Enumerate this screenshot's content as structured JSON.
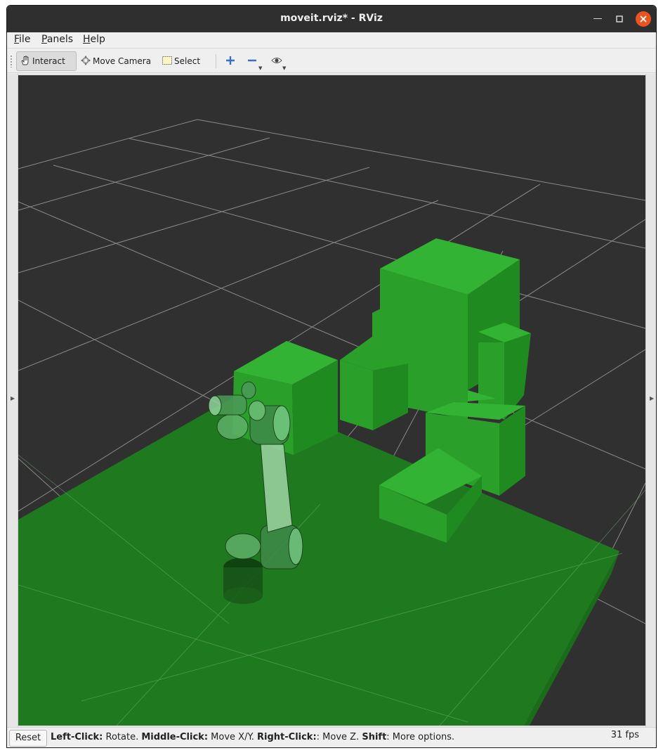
{
  "window": {
    "title": "moveit.rviz* - RViz",
    "minimize_glyph": "—",
    "maximize_glyph": "▫",
    "close_glyph": "✕"
  },
  "menu": {
    "file": "File",
    "panels": "Panels",
    "help": "Help"
  },
  "toolbar": {
    "interact": "Interact",
    "move_camera": "Move Camera",
    "select": "Select",
    "interact_icon": "hand-icon",
    "move_camera_icon": "move-camera-icon",
    "select_icon": "select-box-icon",
    "add_icon": "plus-icon",
    "remove_icon": "minus-icon",
    "view_icon": "eye-icon"
  },
  "status": {
    "reset_label": "Reset",
    "hint_parts": [
      {
        "text": "Left-Click:",
        "bold": true
      },
      {
        "text": " Rotate. ",
        "bold": false
      },
      {
        "text": "Middle-Click:",
        "bold": true
      },
      {
        "text": " Move X/Y. ",
        "bold": false
      },
      {
        "text": "Right-Click:",
        "bold": true
      },
      {
        "text": ": Move Z. ",
        "bold": false
      },
      {
        "text": "Shift",
        "bold": true
      },
      {
        "text": ": More options.",
        "bold": false
      }
    ],
    "fps": "31 fps"
  },
  "scene": {
    "background_color": "#303030",
    "grid_color": "#8a8a8a",
    "planning_scene_color": "#22a022",
    "robot_color": "#8fd69a"
  }
}
